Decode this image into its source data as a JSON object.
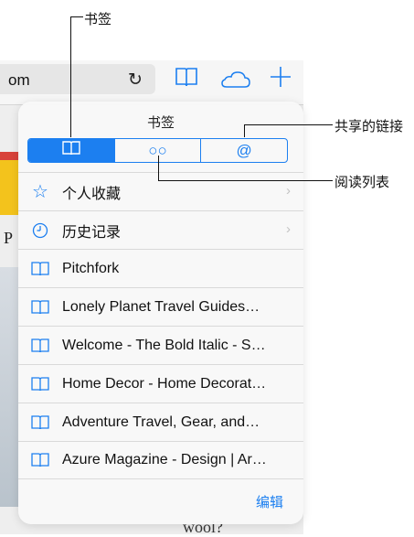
{
  "browser": {
    "address_fragment": "om",
    "reload_glyph": "↻",
    "bg_word": "wool?",
    "bg_letter": "P"
  },
  "popover": {
    "title": "书签",
    "segments": [
      {
        "icon": "open-book-icon"
      },
      {
        "icon": "glasses-icon",
        "glyph": "○○"
      },
      {
        "icon": "at-sign-icon",
        "glyph": "@"
      }
    ],
    "rows": [
      {
        "icon": "star-icon",
        "glyph": "☆",
        "label": "个人收藏",
        "chevron": "›"
      },
      {
        "icon": "clock-icon",
        "label": "历史记录",
        "chevron": "›"
      },
      {
        "icon": "open-book-icon",
        "label": "Pitchfork"
      },
      {
        "icon": "open-book-icon",
        "label": "Lonely Planet Travel Guides…"
      },
      {
        "icon": "open-book-icon",
        "label": "Welcome - The Bold Italic - S…"
      },
      {
        "icon": "open-book-icon",
        "label": "Home Decor - Home Decorat…"
      },
      {
        "icon": "open-book-icon",
        "label": "Adventure Travel, Gear, and…"
      },
      {
        "icon": "open-book-icon",
        "label": "Azure Magazine - Design | Ar…"
      }
    ],
    "edit_label": "编辑"
  },
  "callouts": {
    "bookmarks": "书签",
    "shared_links": "共享的链接",
    "reading_list": "阅读列表"
  },
  "colors": {
    "accent": "#1c7ff0"
  }
}
